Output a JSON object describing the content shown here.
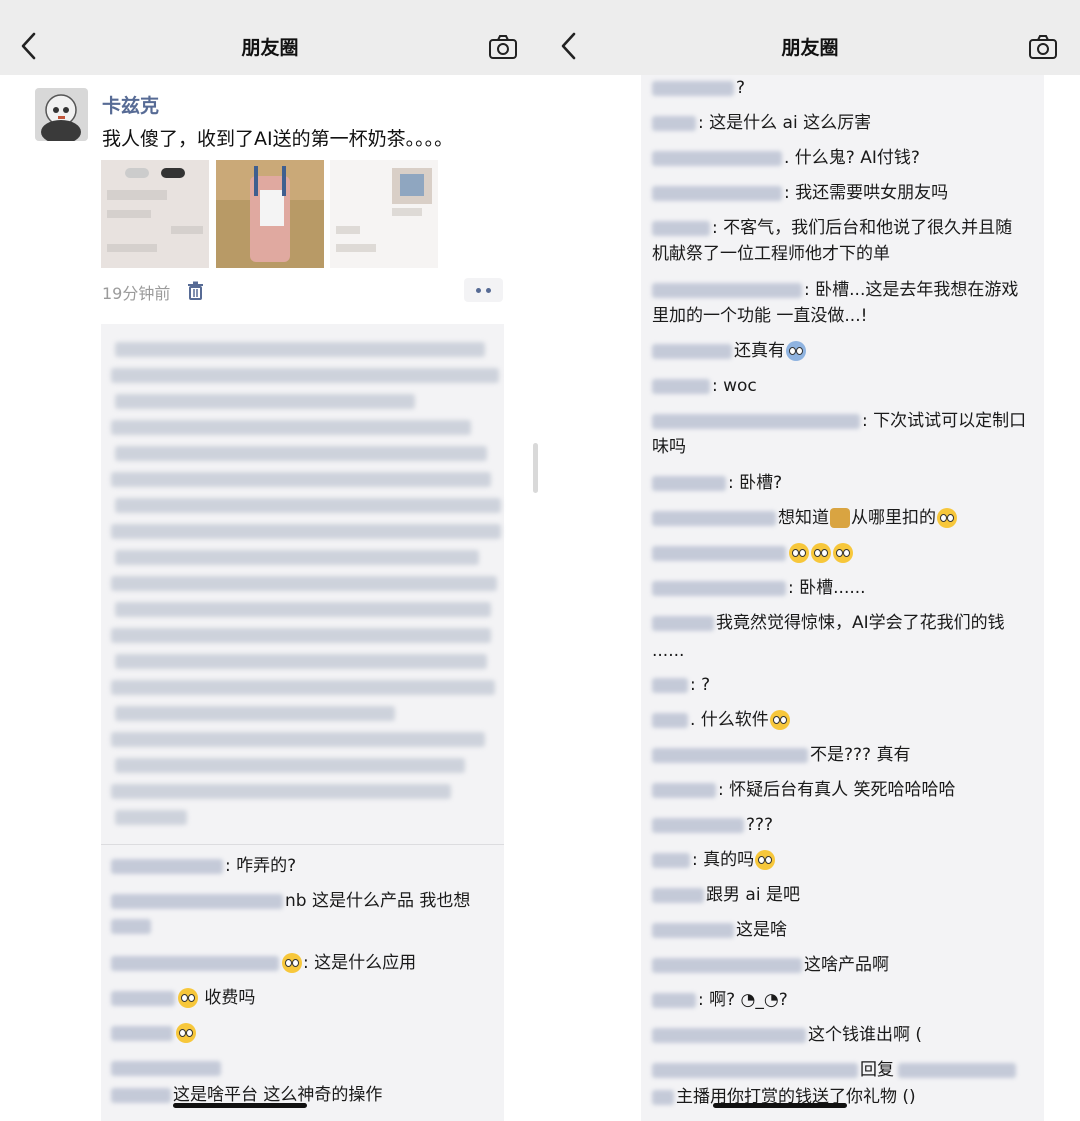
{
  "left": {
    "nav_title": "朋友圈",
    "author": "卡兹克",
    "post_text": "我人傻了，收到了AI送的第一杯奶茶。。。。",
    "time": "19分钟前",
    "comments": [
      {
        "text": ": 咋弄的?"
      },
      {
        "text": "nb 这是什么产品 我也想"
      },
      {
        "text": ":  这是什么应用"
      },
      {
        "text": " 收费吗"
      },
      {
        "text": ""
      },
      {
        "text": "这是啥平台 这么神奇的操作"
      }
    ]
  },
  "right": {
    "nav_title": "朋友圈",
    "comments": [
      {
        "text": "?"
      },
      {
        "text": ": 这是什么 ai 这么厉害"
      },
      {
        "text": ". 什么鬼? AI付钱?"
      },
      {
        "text": ": 我还需要哄女朋友吗"
      },
      {
        "text": ": 不客气，我们后台和他说了很久并且随"
      },
      {
        "text": "机献祭了一位工程师他才下的单"
      },
      {
        "text": ": 卧槽...这是去年我想在游戏"
      },
      {
        "text": "里加的一个功能 一直没做...!"
      },
      {
        "text": "还真有"
      },
      {
        "text": ": woc"
      },
      {
        "text": ": 下次试试可以定制口"
      },
      {
        "text": "味吗"
      },
      {
        "text": ": 卧槽?"
      },
      {
        "text": "想知道"
      },
      {
        "text": "从哪里扣的"
      },
      {
        "text": ": 卧槽......"
      },
      {
        "text": "我竟然觉得惊悚，AI学会了花我们的钱"
      },
      {
        "text": "......"
      },
      {
        "text": ": ?"
      },
      {
        "text": ". 什么软件"
      },
      {
        "text": "不是??? 真有"
      },
      {
        "text": ": 怀疑后台有真人 笑死哈哈哈哈"
      },
      {
        "text": "???"
      },
      {
        "text": ": 真的吗"
      },
      {
        "text": "跟男 ai 是吧"
      },
      {
        "text": "这是啥"
      },
      {
        "text": "这啥产品啊"
      },
      {
        "text": ": 啊? ◔_◔?"
      },
      {
        "text": "这个钱谁出啊 ("
      },
      {
        "text": "回复"
      },
      {
        "text": "主播用你打赏的钱送了你礼物 ()"
      }
    ]
  },
  "colors": {
    "link": "#576b95",
    "nav_bg": "#ededed",
    "comment_bg": "#f3f3f5"
  },
  "icons": [
    "back-icon",
    "camera-icon",
    "trash-icon",
    "more-dots-icon",
    "emoji-icon"
  ]
}
